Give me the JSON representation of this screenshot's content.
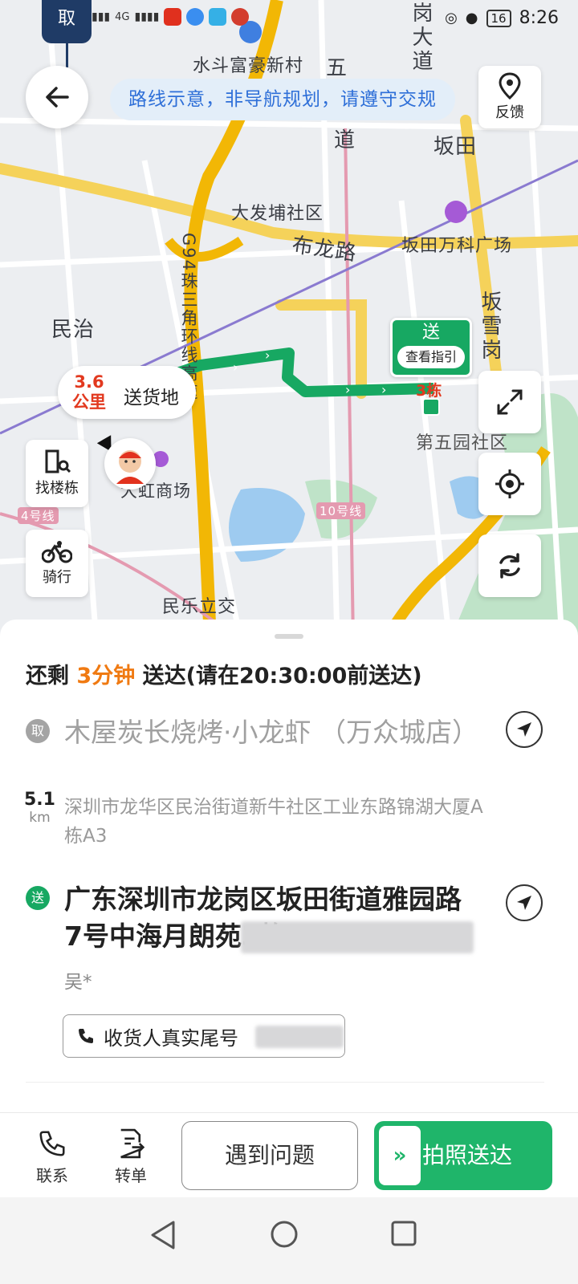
{
  "status_bar": {
    "time": "8:26",
    "battery": "16",
    "signal_text": "4G"
  },
  "floating_app": {
    "label": "取"
  },
  "map": {
    "route_banner": "路线示意，非导航规划，请遵守交规",
    "labels": {
      "shuidou": "水斗富豪新村",
      "wu_road": "五",
      "dao": "道",
      "gangdadao": "岗大道",
      "bantian": "坂田",
      "dafabu": "大发埔社区",
      "bulong_road": "布龙路",
      "vanke": "坂田万科广场",
      "minzhi": "民治",
      "g94": "G94珠三角环线高速",
      "banxue": "坂雪岗",
      "diwuyuan": "第五园社区",
      "dahong": "大虹商场",
      "line10": "10号线",
      "line4": "4号线",
      "minle": "民乐立交"
    },
    "feedback_label": "反馈",
    "distance_value": "3.6",
    "distance_unit": "公里",
    "destination_label": "送货地",
    "send_marker_title": "送",
    "send_marker_guide": "查看指引",
    "building_label": "3栋",
    "find_building_label": "找楼栋",
    "riding_label": "骑行"
  },
  "sheet": {
    "eta_prefix": "还剩",
    "eta_minutes": "3分钟",
    "eta_suffix": "送达(请在20:30:00前送达)",
    "pickup": {
      "badge": "取",
      "name": "木屋炭长烧烤·小龙虾 （万众城店）",
      "address": "深圳市龙华区民治街道新牛社区工业东路锦湖大厦A栋A3",
      "distance_value": "5.1",
      "distance_unit": "km"
    },
    "delivery": {
      "badge": "送",
      "address_line": "广东深圳市龙岗区坂田街道雅园路7号中海月朗苑3栋",
      "receiver": "吴*",
      "phone_label": "收货人真实尾号"
    }
  },
  "actions": {
    "contact_label": "联系",
    "transfer_label": "转单",
    "issue_label": "遇到问题",
    "deliver_label": "拍照送达",
    "deliver_visible": "拍照送达"
  },
  "colors": {
    "route_green": "#17a862",
    "eta_orange": "#f07a12",
    "distance_red": "#e2391f",
    "banner_blue": "#2e6fd8"
  }
}
